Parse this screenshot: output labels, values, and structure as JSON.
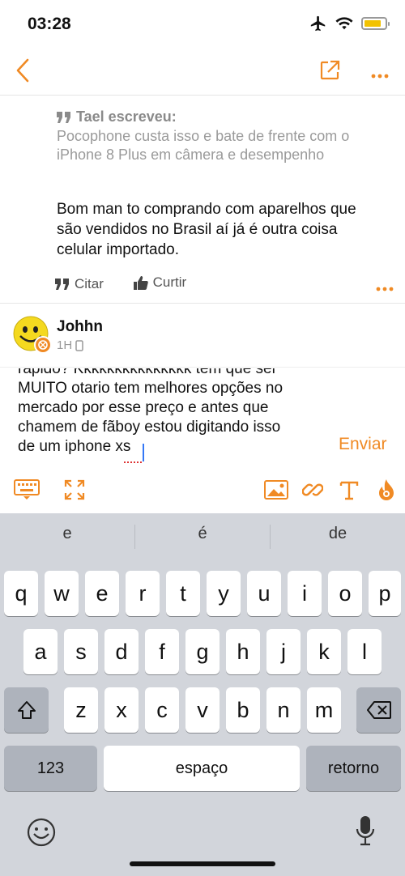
{
  "status_bar": {
    "time": "03:28"
  },
  "nav": {
    "back_icon": "chevron-left-icon",
    "share_icon": "share-icon",
    "more_icon": "more-icon"
  },
  "quote": {
    "author_line": "Tael escreveu:",
    "text": "Pocophone custa isso e bate de frente com o iPhone 8 Plus em câmera e desempenho"
  },
  "post": {
    "body": "Bom man to comprando com aparelhos que são vendidos no Brasil aí já é outra coisa celular importado.",
    "quote_label": "Citar",
    "like_label": "Curtir"
  },
  "reply": {
    "user_name": "Johhn",
    "time_ago": "1H",
    "compose_text": "rapido? Kkkkkkkkkkkkkkk tem que ser\nMUITO otario tem melhores opções no\nmercado por esse preço e antes que\nchamem de fãboy estou digitando isso\nde um iphone xs",
    "send_label": "Enviar"
  },
  "keyboard": {
    "suggestions": [
      "e",
      "é",
      "de"
    ],
    "row1": [
      "q",
      "w",
      "e",
      "r",
      "t",
      "y",
      "u",
      "i",
      "o",
      "p"
    ],
    "row2": [
      "a",
      "s",
      "d",
      "f",
      "g",
      "h",
      "j",
      "k",
      "l"
    ],
    "row3": [
      "z",
      "x",
      "c",
      "v",
      "b",
      "n",
      "m"
    ],
    "numbers_label": "123",
    "space_label": "espaço",
    "return_label": "retorno"
  },
  "colors": {
    "accent": "#f08a24",
    "keyboard_bg": "#d2d5db"
  }
}
